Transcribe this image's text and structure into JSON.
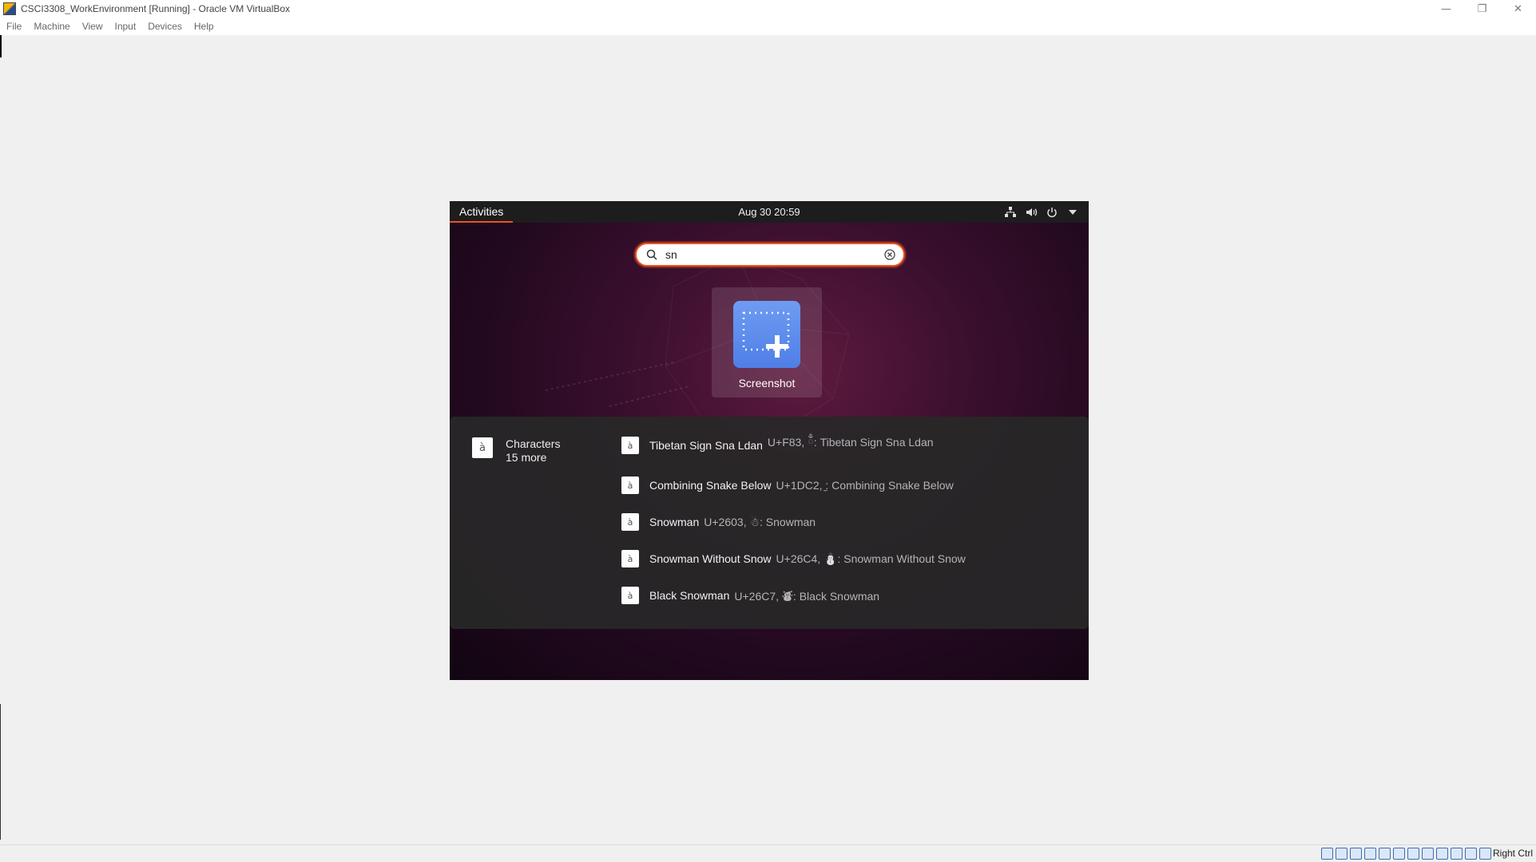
{
  "host": {
    "title": "CSCI3308_WorkEnvironment [Running] - Oracle VM VirtualBox",
    "controls": {
      "minimize": "—",
      "restore": "❐",
      "close": "✕"
    },
    "menu": [
      "File",
      "Machine",
      "View",
      "Input",
      "Devices",
      "Help"
    ],
    "host_key": "Right Ctrl"
  },
  "guest": {
    "topbar": {
      "activities": "Activities",
      "datetime": "Aug 30  20:59"
    },
    "search": {
      "value": "sn"
    },
    "app_result": {
      "label": "Screenshot"
    },
    "characters": {
      "icon_glyph": "à",
      "provider_name": "Characters",
      "more": "15 more",
      "results": [
        {
          "title": "Tibetan Sign Sna Ldan",
          "desc": "U+F83, ྃ: Tibetan Sign Sna Ldan"
        },
        {
          "title": "Combining Snake Below",
          "desc": "U+1DC2, ̼: Combining Snake Below"
        },
        {
          "title": "Snowman",
          "desc": "U+2603, ☃: Snowman"
        },
        {
          "title": "Snowman Without Snow",
          "desc": "U+26C4, ⛄: Snowman Without Snow"
        },
        {
          "title": "Black Snowman",
          "desc": "U+26C7, ⛇: Black Snowman"
        }
      ]
    }
  },
  "colors": {
    "accent": "#e95420",
    "topbar": "#1d1d1d",
    "screenshot_icon": "#5b8bee"
  }
}
